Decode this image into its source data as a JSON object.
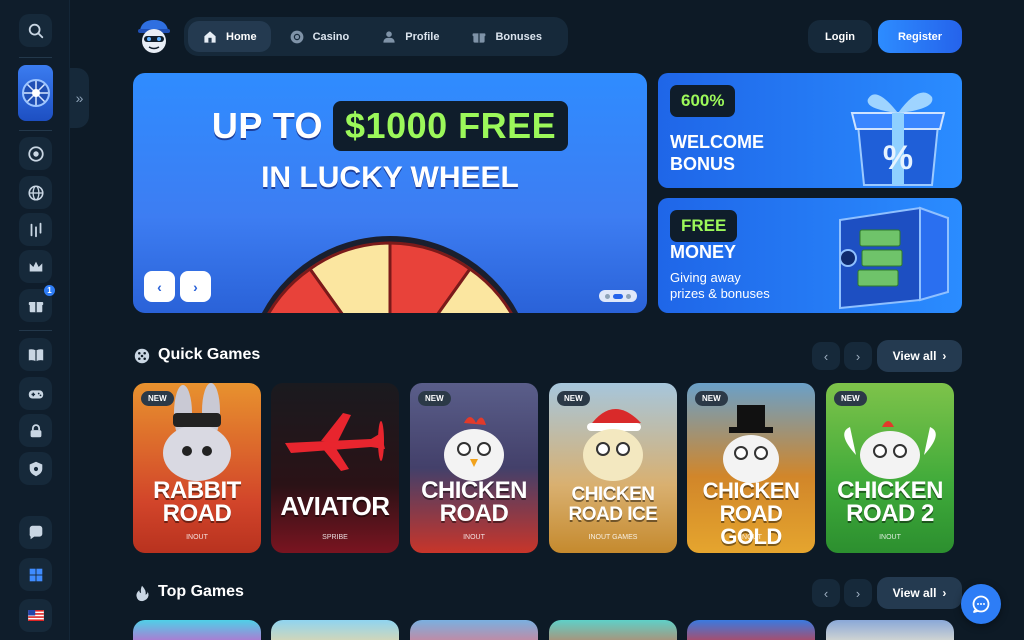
{
  "nav": {
    "items": [
      {
        "label": "Home",
        "icon": "home-icon"
      },
      {
        "label": "Casino",
        "icon": "chip-icon"
      },
      {
        "label": "Profile",
        "icon": "user-icon"
      },
      {
        "label": "Bonuses",
        "icon": "gift-icon"
      }
    ],
    "login": "Login",
    "register": "Register"
  },
  "sidebar": {
    "badge_count": "1",
    "icons": [
      "search-icon",
      "wheel-icon",
      "chip-icon",
      "globe-icon",
      "stats-icon",
      "crown-icon",
      "gift-icon",
      "book-icon",
      "gamepad-icon",
      "lock-icon",
      "shield-icon",
      "chat-icon",
      "windows-icon",
      "flag-us-icon"
    ]
  },
  "hero": {
    "line1_a": "UP TO",
    "line1_b": "$1000 FREE",
    "line2": "IN LUCKY WHEEL",
    "prev": "‹",
    "next": "›"
  },
  "promos": [
    {
      "tag": "600%",
      "title_1": "WELCOME",
      "title_2": "BONUS"
    },
    {
      "tag": "FREE",
      "title_1": "MONEY",
      "sub_1": "Giving away",
      "sub_2": "prizes & bonuses"
    }
  ],
  "quick_games": {
    "title": "Quick Games",
    "view_all": "View all",
    "games": [
      {
        "name_1": "RABBIT",
        "name_2": "ROAD",
        "provider": "INOUT",
        "new": "NEW"
      },
      {
        "name_1": "AVIATOR",
        "name_2": "",
        "provider": "SPRIBE",
        "new": ""
      },
      {
        "name_1": "CHICKEN",
        "name_2": "ROAD",
        "provider": "INOUT",
        "new": "NEW"
      },
      {
        "name_1": "CHICKEN",
        "name_2": "ROAD ICE",
        "provider": "INOUT GAMES",
        "new": "NEW"
      },
      {
        "name_1": "CHICKEN",
        "name_2": "ROAD GOLD",
        "provider": "INOUT",
        "new": "NEW"
      },
      {
        "name_1": "CHICKEN",
        "name_2": "ROAD 2",
        "provider": "INOUT",
        "new": "NEW"
      }
    ]
  },
  "top_games": {
    "title": "Top Games",
    "view_all": "View all"
  },
  "colors": {
    "bg": "#0d1a26",
    "panel": "#16293a",
    "accent": "#2d7df6",
    "green": "#9cf85a"
  }
}
